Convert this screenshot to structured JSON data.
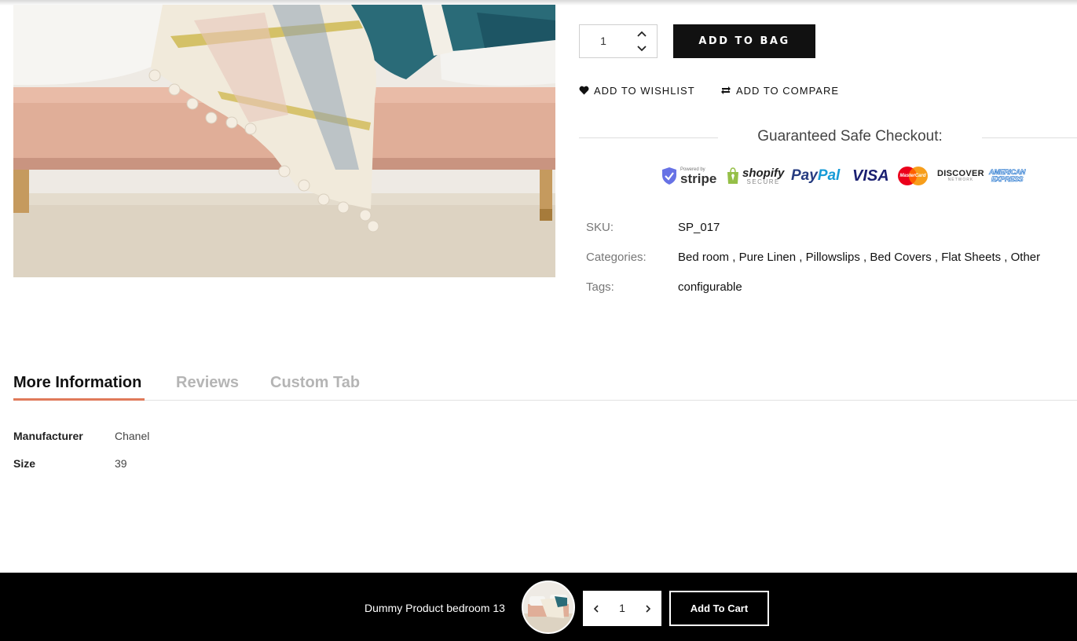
{
  "product": {
    "image_alt": "bedroom bed with tasseled throw blankets",
    "quantity": "1",
    "add_to_bag_label": "ADD TO BAG",
    "wishlist_label": "ADD TO WISHLIST",
    "compare_label": "ADD TO COMPARE"
  },
  "checkout": {
    "title": "Guaranteed Safe Checkout:",
    "payment_logos": {
      "stripe_small": "Powered by",
      "stripe": "stripe",
      "shopify": "shopify",
      "shopify_sub": "SECURE",
      "paypal_pay": "Pay",
      "paypal_pal": "Pal",
      "visa": "VISA",
      "mastercard": "MasterCard",
      "discover": "DISCOVER",
      "discover_sub": "NETWORK",
      "amex_top": "AMERICAN",
      "amex_bottom": "EXPRESS"
    }
  },
  "meta": {
    "sku_label": "SKU:",
    "sku_value": "SP_017",
    "categories_label": "Categories:",
    "categories": [
      "Bed room",
      "Pure Linen",
      "Pillowslips",
      "Bed Covers",
      "Flat Sheets",
      "Other"
    ],
    "tags_label": "Tags:",
    "tags_value": "configurable"
  },
  "tabs": [
    {
      "label": "More Information",
      "active": true
    },
    {
      "label": "Reviews",
      "active": false
    },
    {
      "label": "Custom Tab",
      "active": false
    }
  ],
  "more_info": [
    {
      "label": "Manufacturer",
      "value": "Chanel"
    },
    {
      "label": "Size",
      "value": "39"
    }
  ],
  "sticky_bar": {
    "product_name": "Dummy Product bedroom 13",
    "quantity": "1",
    "add_to_cart_label": "Add To Cart"
  },
  "colors": {
    "accent_underline": "#e07a5a",
    "button_bg": "#111111",
    "sticky_bg": "#000000"
  }
}
